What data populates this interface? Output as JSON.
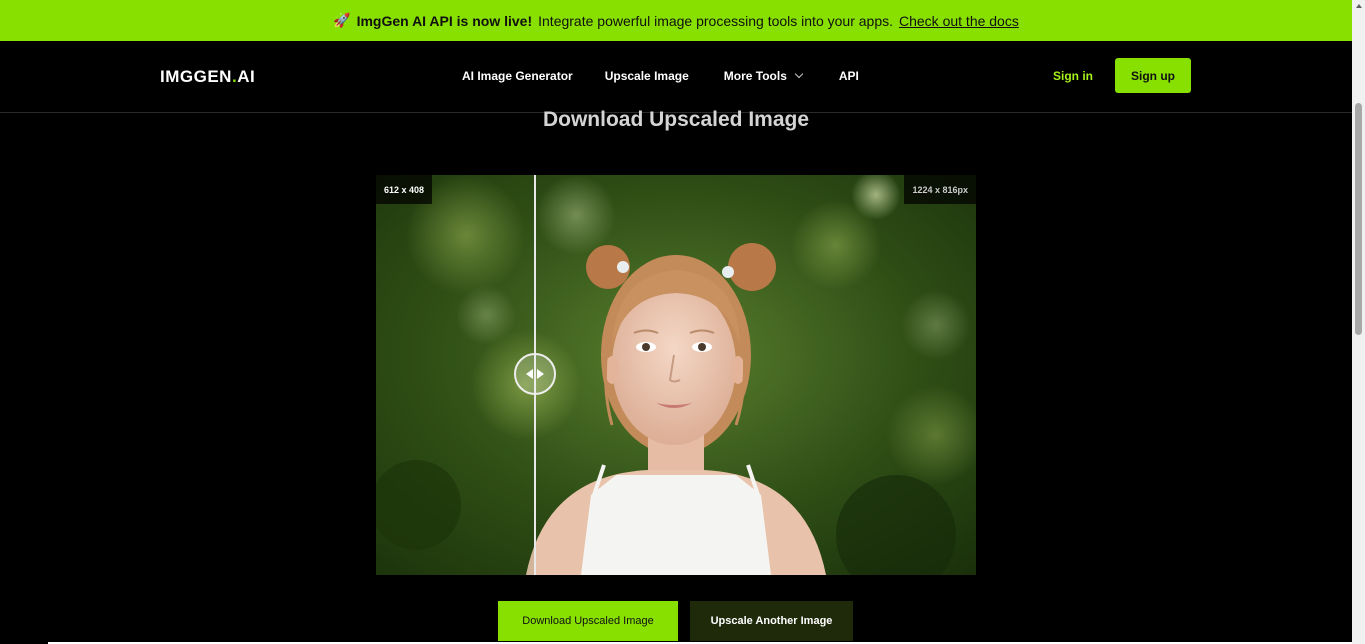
{
  "announcement": {
    "icon": "rocket-icon",
    "headline": "ImgGen AI API is now live!",
    "text": "Integrate powerful image processing tools into your apps.",
    "link": "Check out the docs",
    "background": "#88e000"
  },
  "header": {
    "logo_main": "IMGGEN",
    "logo_dot": ".",
    "logo_suffix": "AI",
    "nav": [
      {
        "label": "AI Image Generator"
      },
      {
        "label": "Upscale Image"
      },
      {
        "label": "More Tools"
      },
      {
        "label": "API"
      }
    ],
    "signin": "Sign in",
    "signup": "Sign up"
  },
  "main": {
    "title": "Download Upscaled Image",
    "viewer": {
      "original_size": "612 x 408",
      "upscaled_size": "1224 x 816px",
      "divider_position_fraction": 0.265
    },
    "download_button": "Download Upscaled Image",
    "another_button": "Upscale Another Image"
  },
  "colors": {
    "accent": "#88e000",
    "background": "#000000",
    "dark_button": "#1e2a0a"
  }
}
